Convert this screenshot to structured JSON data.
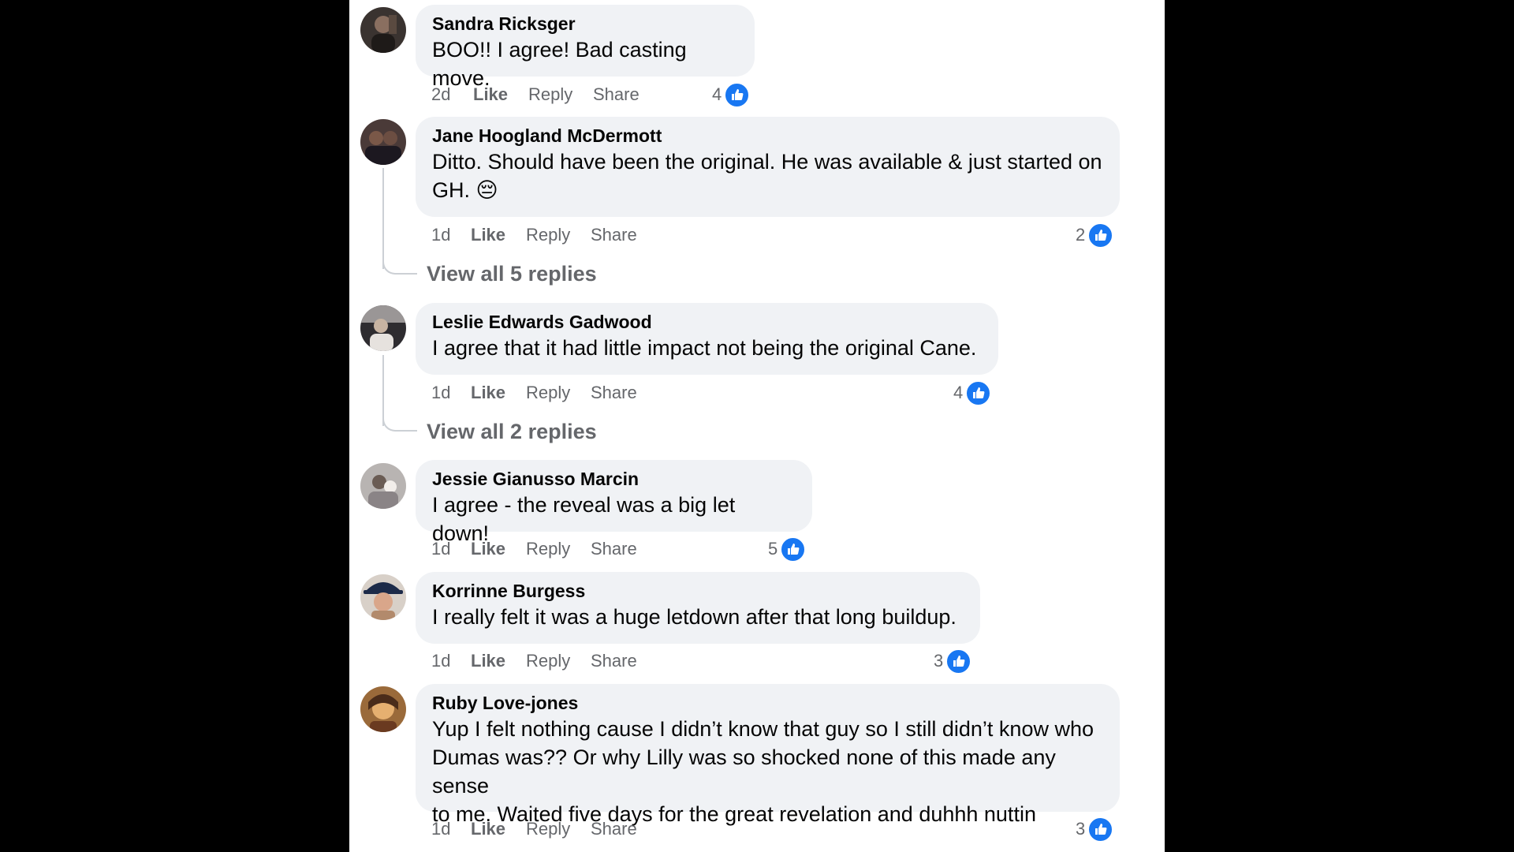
{
  "labels": {
    "like": "Like",
    "reply": "Reply",
    "share": "Share"
  },
  "icons": {
    "reaction": "like-icon"
  },
  "colors": {
    "like_blue": "#1877f2",
    "bubble_bg": "#f0f2f5",
    "meta_grey": "#65676b"
  },
  "comments": [
    {
      "author": "Sandra Ricksger",
      "lines": [
        "BOO!! I agree! Bad casting move."
      ],
      "time": "2d",
      "reactions": "4"
    },
    {
      "author": "Jane Hoogland McDermott",
      "lines": [
        "Ditto. Should have been the original. He was available & just started on",
        "GH. 😔"
      ],
      "time": "1d",
      "reactions": "2",
      "view_replies": "View all 5 replies"
    },
    {
      "author": "Leslie Edwards Gadwood",
      "lines": [
        "I agree that it had little impact not being the original Cane."
      ],
      "time": "1d",
      "reactions": "4",
      "view_replies": "View all 2 replies"
    },
    {
      "author": "Jessie Gianusso Marcin",
      "lines": [
        "I agree - the reveal was a big let down!"
      ],
      "time": "1d",
      "reactions": "5"
    },
    {
      "author": "Korrinne Burgess",
      "lines": [
        "I really felt it was a huge letdown after that long buildup."
      ],
      "time": "1d",
      "reactions": "3"
    },
    {
      "author": "Ruby Love-jones",
      "lines": [
        "Yup I felt nothing cause I didn’t know that guy so I still didn’t know who",
        "Dumas was?? Or why Lilly was so shocked none of this made any sense",
        "to me. Waited five days for the great revelation and duhhh nuttin"
      ],
      "time": "1d",
      "reactions": "3"
    }
  ]
}
